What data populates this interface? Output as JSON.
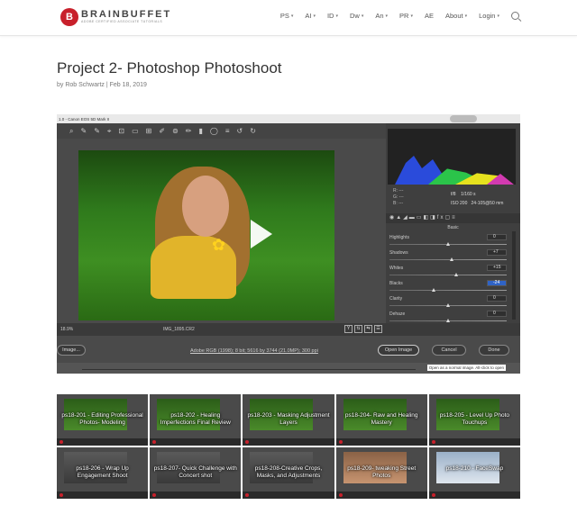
{
  "header": {
    "logo": {
      "name": "BRAINBUFFET",
      "tagline": "ADOBE CERTIFIED ASSOCIATE TUTORIALS"
    },
    "nav": [
      {
        "label": "PS",
        "dropdown": true
      },
      {
        "label": "AI",
        "dropdown": true
      },
      {
        "label": "ID",
        "dropdown": true
      },
      {
        "label": "Dw",
        "dropdown": true
      },
      {
        "label": "An",
        "dropdown": true
      },
      {
        "label": "PR",
        "dropdown": true
      },
      {
        "label": "AE",
        "dropdown": false
      },
      {
        "label": "About",
        "dropdown": true
      },
      {
        "label": "Login",
        "dropdown": true
      }
    ]
  },
  "post": {
    "title": "Project 2- Photoshop Photoshoot",
    "meta": "by Rob Schwartz | Feb 18, 2019"
  },
  "video": {
    "window_title": "1.0 - Canon EOS 5D Mark II",
    "filename": "IMG_1895.CR2",
    "zoom": "18.9%",
    "rgb": {
      "r": "R:",
      "g": "G:",
      "b": "B:",
      "rv": "---",
      "gv": "---",
      "bv": "---"
    },
    "exif": {
      "aperture": "f/8",
      "shutter": "1/160 s",
      "iso": "ISO 200",
      "lens": "24-105@50 mm"
    },
    "panel_label": "Basic",
    "sliders": [
      {
        "label": "Highlights",
        "value": "0",
        "pos": 0.5
      },
      {
        "label": "Shadows",
        "value": "+7",
        "pos": 0.53
      },
      {
        "label": "Whites",
        "value": "+15",
        "pos": 0.57
      },
      {
        "label": "Blacks",
        "value": "-24",
        "pos": 0.38,
        "highlight": true
      },
      {
        "label": "Clarity",
        "value": "0",
        "pos": 0.5
      },
      {
        "label": "Dehaze",
        "value": "0",
        "pos": 0.5
      }
    ],
    "buttons": {
      "image": "Image...",
      "open": "Open Image",
      "cancel": "Cancel",
      "done": "Done"
    },
    "info_link": "Adobe RGB (1998); 8 bit; 5616 by 3744 (21.0MP); 300 ppi",
    "tooltip": "Open as a normal image. Alt-click to open"
  },
  "playlist": [
    {
      "label": "ps18-201 - Editing Professional Photos- Modeling",
      "style": "a"
    },
    {
      "label": "ps18-202 - Healing Imperfections Final Review",
      "style": "a"
    },
    {
      "label": "ps18-203 - Masking Adjustment Layers",
      "style": "a"
    },
    {
      "label": "ps18-204- Raw and Healing Mastery",
      "style": "a"
    },
    {
      "label": "ps18-205 - Level Up Photo Touchups",
      "style": "a"
    },
    {
      "label": "ps18-206 - Wrap Up Engagement Shoot",
      "style": "b"
    },
    {
      "label": "ps18-207- Quick Challenge with Concert shot",
      "style": "b"
    },
    {
      "label": "ps18-208-Creative Crops, Masks, and Adjustments",
      "style": "b"
    },
    {
      "label": "ps18-209- tweaking Street Photos",
      "style": "c"
    },
    {
      "label": "ps18-210 - FaceSwap",
      "style": "d"
    }
  ]
}
